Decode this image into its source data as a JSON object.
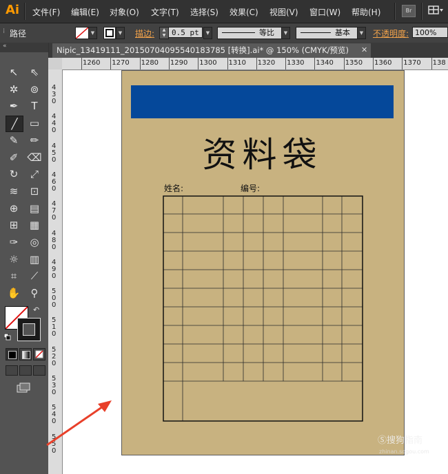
{
  "app": {
    "logo": "Ai"
  },
  "menu": [
    "文件(F)",
    "编辑(E)",
    "对象(O)",
    "文字(T)",
    "选择(S)",
    "效果(C)",
    "视图(V)",
    "窗口(W)",
    "帮助(H)"
  ],
  "menu_right": {
    "bridge": "Br"
  },
  "control_bar": {
    "object_label": "路径",
    "stroke_label": "描边:",
    "stroke_value": "0.5 pt",
    "profile_label": "等比",
    "brush_label": "基本",
    "opacity_label": "不透明度:",
    "opacity_value": "100%"
  },
  "tab": {
    "title": "Nipic_13419111_20150704095540183785 [转换].ai* @ 150% (CMYK/预览)",
    "close": "✕"
  },
  "ruler_h": [
    "1260",
    "1270",
    "1280",
    "1290",
    "1300",
    "1310",
    "1320",
    "1330",
    "1340",
    "1350",
    "1360",
    "1370",
    "138"
  ],
  "ruler_v": [
    "4\n3\n0",
    "4\n4\n0",
    "4\n5\n0",
    "4\n6\n0",
    "4\n7\n0",
    "4\n8\n0",
    "4\n9\n0",
    "5\n0\n0",
    "5\n1\n0",
    "5\n2\n0",
    "5\n3\n0",
    "5\n4\n0",
    "5\n5\n0"
  ],
  "document": {
    "title": "资料袋",
    "name_label": "姓名:",
    "number_label": "编号:",
    "banner_color": "#05489a",
    "artboard_color": "#c8b280"
  },
  "watermark": {
    "main": "Ⓢ搜狗指南",
    "sub": "zhinan.sogou.com"
  }
}
